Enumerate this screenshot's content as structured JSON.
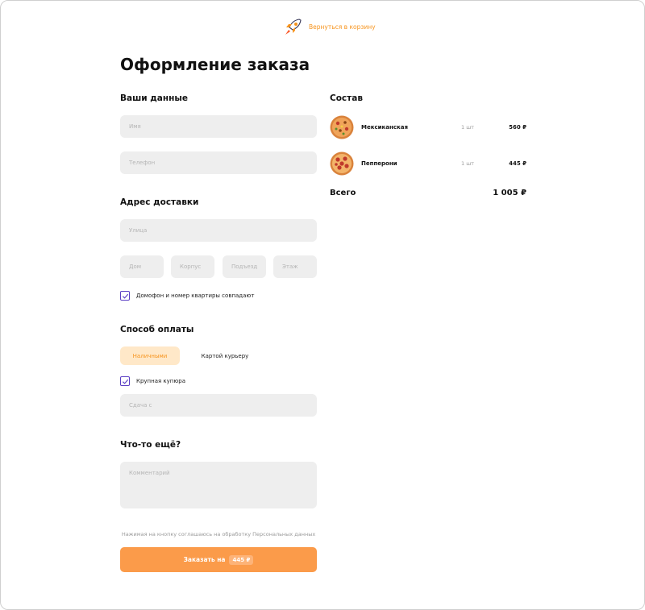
{
  "header": {
    "back_link": "Вернуться в корзину"
  },
  "page_title": "Оформление заказа",
  "your_data": {
    "title": "Ваши данные",
    "name_placeholder": "Имя",
    "phone_placeholder": "Телефон"
  },
  "address": {
    "title": "Адрес доставки",
    "street_placeholder": "Улица",
    "house_placeholder": "Дом",
    "building_placeholder": "Корпус",
    "entrance_placeholder": "Подъезд",
    "floor_placeholder": "Этаж",
    "intercom_checkbox_label": "Домофон и номер квартиры совпадают",
    "intercom_checked": true
  },
  "payment": {
    "title": "Способ оплаты",
    "options": [
      "Наличными",
      "Картой курьеру"
    ],
    "selected": "Наличными",
    "large_bill_label": "Крупная купюра",
    "large_bill_checked": true,
    "change_placeholder": "Сдача с"
  },
  "extra": {
    "title": "Что-то ещё?",
    "comment_placeholder": "Комментарий"
  },
  "consent_text": "Нажимая на кнопку соглашаюсь на обработку Персональных данных",
  "submit": {
    "label": "Заказать на",
    "price": "445 ₽"
  },
  "order": {
    "title": "Состав",
    "items": [
      {
        "name": "Мексиканская",
        "qty": "1 шт",
        "price": "560 ₽"
      },
      {
        "name": "Пепперони",
        "qty": "1 шт",
        "price": "445 ₽"
      }
    ],
    "total_label": "Всего",
    "total_value": "1 005 ₽"
  },
  "colors": {
    "accent": "#f7941d",
    "button": "#fb9b4a",
    "checkbox": "#5b3fc4",
    "field_bg": "#eeeeee"
  }
}
